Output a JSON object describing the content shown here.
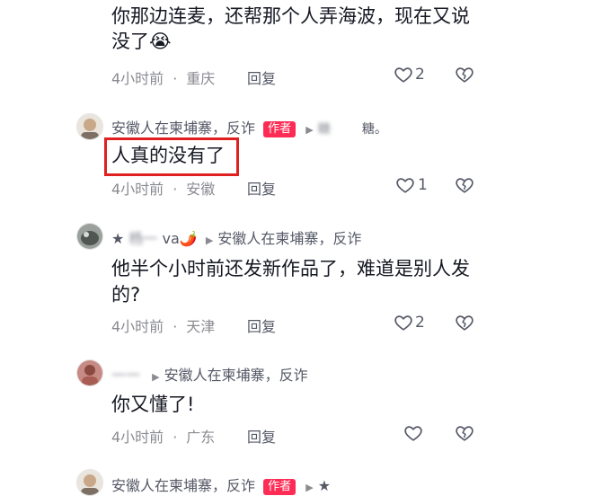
{
  "comment1": {
    "text_line1": "你那边连麦，还帮那个人弄海波，现在又说",
    "text_line2": "没了",
    "emoji": "😭",
    "time": "4小时前",
    "location": "重庆",
    "reply_label": "回复",
    "likes": "2"
  },
  "comment2": {
    "username": "安徽人在柬埔寨，反诈",
    "badge": "作者",
    "reply_to": "糖。",
    "text": "人真的没有了",
    "time": "4小时前",
    "location": "安徽",
    "reply_label": "回复",
    "likes": "1"
  },
  "comment3": {
    "username_prefix": "★",
    "username_suffix": "va🌶️",
    "reply_to": "安徽人在柬埔寨，反诈",
    "text_line1": "他半个小时前还发新作品了，难道是别人发",
    "text_line2": "的?",
    "time": "4小时前",
    "location": "天津",
    "reply_label": "回复",
    "likes": "2"
  },
  "comment4": {
    "reply_to": "安徽人在柬埔寨，反诈",
    "text": "你又懂了!",
    "time": "4小时前",
    "location": "广东",
    "reply_label": "回复"
  },
  "comment5": {
    "username": "安徽人在柬埔寨，反诈",
    "badge": "作者",
    "reply_to_prefix": "★"
  },
  "colors": {
    "author_badge": "#fe2c55",
    "highlight_box": "#e02020",
    "meta_text": "#8a8b91"
  },
  "icons": {
    "like": "heart-outline-icon",
    "dislike": "broken-heart-icon",
    "reply_arrow": "triangle-right-icon"
  }
}
